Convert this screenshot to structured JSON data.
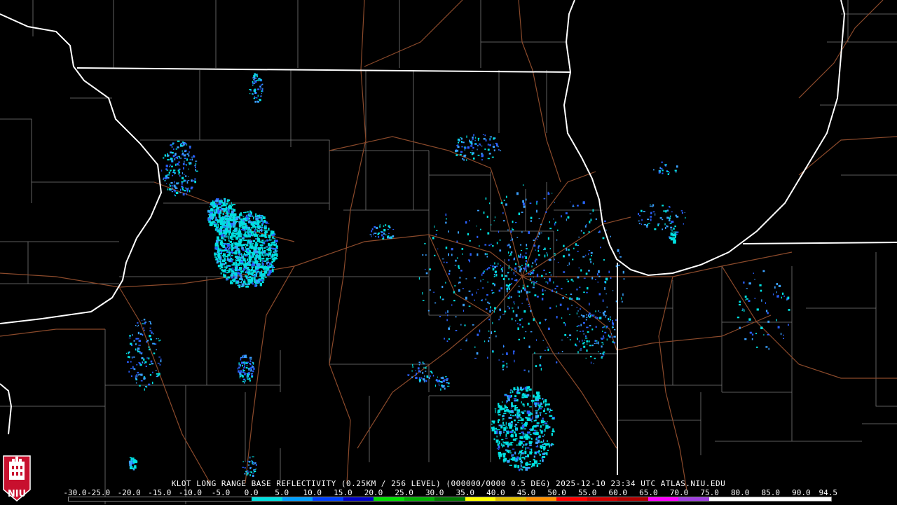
{
  "product": {
    "caption": "KLOT LONG RANGE BASE REFLECTIVITY (0.25KM / 256 LEVEL) (000000/0000 0.5 DEG) 2025-12-10 23:34 UTC  ATLAS.NIU.EDU"
  },
  "scale": {
    "labels": [
      "-30.0",
      "-25.0",
      "-20.0",
      "-15.0",
      "-10.0",
      "-5.0",
      "0.0",
      "5.0",
      "10.0",
      "15.0",
      "20.0",
      "25.0",
      "30.0",
      "35.0",
      "40.0",
      "45.0",
      "50.0",
      "55.0",
      "60.0",
      "65.0",
      "70.0",
      "75.0",
      "80.0",
      "85.0",
      "90.0",
      "94.5"
    ],
    "colors": [
      "#000000",
      "#000000",
      "#000000",
      "#000000",
      "#000000",
      "#000000",
      "#00e0e0",
      "#00a0ff",
      "#0040ff",
      "#0000c8",
      "#00e000",
      "#00b000",
      "#007800",
      "#ffff00",
      "#e0c000",
      "#ff9000",
      "#ff0000",
      "#d00000",
      "#b00000",
      "#ff00ff",
      "#a040e0",
      "#ffffff",
      "#ffffff",
      "#ffffff",
      "#ffffff"
    ]
  },
  "logo": {
    "text": "NIU",
    "color": "#c8102e"
  },
  "map": {
    "border_color": "#ffffff",
    "county_color": "#7a7a7a",
    "road_color": "#8b4a2b",
    "echo_colors": [
      "#00e0e0",
      "#3aa0ff",
      "#2a60ff"
    ]
  }
}
